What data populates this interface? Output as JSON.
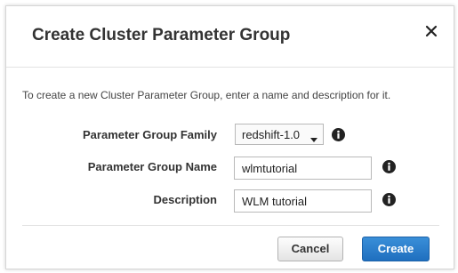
{
  "dialog": {
    "title": "Create Cluster Parameter Group",
    "intro": "To create a new Cluster Parameter Group, enter a name and description for it."
  },
  "form": {
    "family_label": "Parameter Group Family",
    "family_value": "redshift-1.0",
    "name_label": "Parameter Group Name",
    "name_value": "wlmtutorial",
    "description_label": "Description",
    "description_value": "WLM tutorial"
  },
  "buttons": {
    "cancel": "Cancel",
    "create": "Create"
  },
  "icons": {
    "close": "close-icon",
    "info": "info-icon",
    "caret": "caret-down-icon"
  },
  "colors": {
    "primary_button": "#2a7ccc",
    "title_text": "#333333"
  }
}
